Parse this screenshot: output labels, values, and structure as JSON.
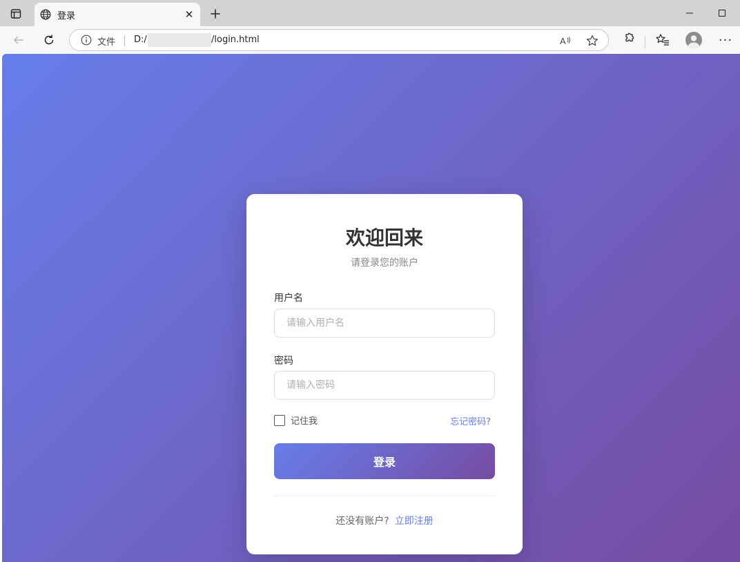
{
  "browser": {
    "tab": {
      "title": "登录",
      "close_glyph": "✕",
      "favicon": "globe-icon"
    },
    "new_tab_icon": "plus-icon",
    "address": {
      "file_label": "文件",
      "url_prefix": "D:/",
      "url_suffix": "/login.html"
    },
    "more_glyph": "···"
  },
  "login": {
    "title": "欢迎回来",
    "subtitle": "请登录您的账户",
    "username_label": "用户名",
    "username_placeholder": "请输入用户名",
    "username_value": "",
    "password_label": "密码",
    "password_placeholder": "请输入密码",
    "password_value": "",
    "remember_label": "记住我",
    "remember_checked": false,
    "forgot_label": "忘记密码?",
    "submit_label": "登录",
    "no_account_text": "还没有账户?",
    "signup_label": "立即注册"
  },
  "colors": {
    "gradient_start": "#667eea",
    "gradient_end": "#764ba2",
    "link": "#667eea"
  }
}
